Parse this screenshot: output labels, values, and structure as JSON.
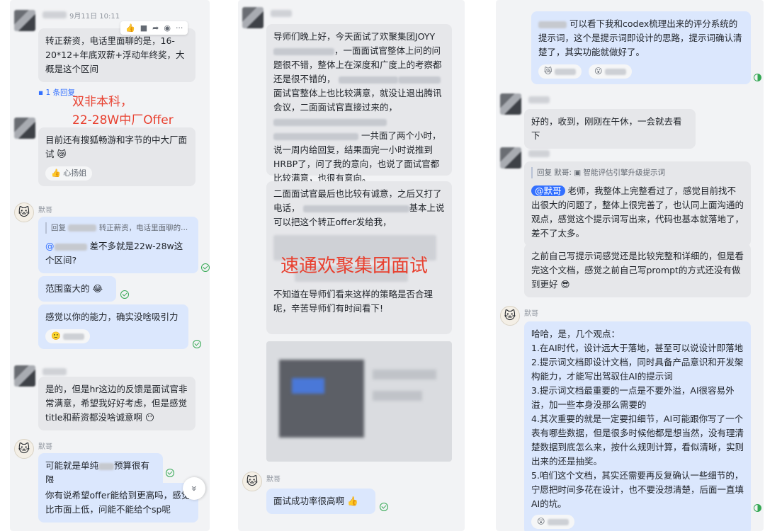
{
  "panel1": {
    "msg1_time": "9月11日 10:11",
    "toolbar_icons": [
      "👍",
      "■",
      "➦",
      "◉",
      "···"
    ],
    "msg1_text": "转正薪资，电话里面聊的是，16-20*12+年底双薪+浮动年终奖，大概是这个区间",
    "reply_count": "1 条回复",
    "red_title_1": "双非本科，",
    "red_title_2": "22-28W中厂Offer",
    "msg2_text": "目前还有搜狐畅游和字节的中大厂面试",
    "msg2_emoji": "😿",
    "msg2_reaction": "心扬姐",
    "sender_moge": "默哥",
    "msg3_quote_prefix": "回复",
    "msg3_quote_text": "转正薪资，电话里面聊的...",
    "msg3_at": "@",
    "msg3_text": "差不多就是22w-28w这个区间?",
    "msg4_text": "范围蛮大的",
    "msg4_emoji": "😂",
    "msg5_text": "感觉以你的能力，确实没啥吸引力",
    "msg5_reaction_emoji": "🙂",
    "msg6_text": "是的，但是hr这边的反馈是面试官非常满意，希望我好好考虑，但是感觉title和薪资都没啥诚意啊",
    "msg6_emoji": "😶",
    "sender_moge2": "默哥",
    "msg7_text_a": "可能就是单纯",
    "msg7_text_b": "预算很有限",
    "msg8_text": "你有说希望offer能给到更高吗，感觉比市面上低，问能不能给个sp呢",
    "fab_icon": "«"
  },
  "panel2": {
    "msg1_p1": "导师们晚上好，今天面试了欢聚集团JOYY",
    "msg1_p2": "，一面面试官整体上问的问题很不错，整体上在深度和广度上的考察都还是很不错的，",
    "msg1_p3": "面试官整体上也比较满意，就没让退出腾讯会议，二面面试官直接过来的，",
    "msg1_p4": "一共面了两个小时，说一周内给回复，结果面完一小时说推到HRBP了，问了我的意向，也说了面试官都比较满意，也很有意向。",
    "msg2_p1": "二面面试官最后也比较有诚意，之后又打了电话，",
    "msg2_p2": "基本上说可以把这个转正offer发给我，",
    "red_title": "速通欢聚集团面试",
    "msg2_p3": "不知道在导师们看来这样的策略是否合理呢，辛苦导师们有时间看下!",
    "sender_moge": "默哥",
    "msg3_text": "面试成功率很高啊",
    "msg3_emoji": "👍"
  },
  "panel3": {
    "msg1_text": "可以看下我和codex梳理出来的评分系统的提示词，这个是提示词即设计的思路，提示词确认清楚了，其实功能就做好了。",
    "msg1_reactions": [
      "😿",
      "😮"
    ],
    "msg2_text": "好的，收到，刚刚在午休，一会就去看下",
    "msg3_quote": "回复 默哥: ▣ 智能评估引擎升级提示词",
    "msg3_mention": "@默哥",
    "msg3_text": "老师，我整体上完整看过了，感觉目前找不出很大的问题了，整体上很完善了，也认同上面沟通的观点，感觉这个提示词写出来，代码也基本就落地了，差不了太多。",
    "msg4_text": "之前自己写提示词感觉还是比较完整和详细的，但是看完这个文档，感觉之前自己写prompt的方式还没有做到更好",
    "msg4_emoji": "😎",
    "sender_moge": "默哥",
    "msg5_lines": [
      "哈哈，是，几个观点：",
      "1.在AI时代，设计远大于落地，甚至可以说设计即落地",
      "2.提示词文档即设计文档，同时具备产品意识和开发架构能力，才能写出驾驭住AI的提示词",
      "3.提示词文档最重要的一点是不要外溢，AI很容易外溢，加一些本身没那么需要的",
      "4.其次重要的就是一定要扣细节，AI可能跟你写了一个表有哪些数据，但是很多时候他都是想当然，没有理清楚数据到底怎么来，按什么规则计算，看似清晰，实则出来的还是抽奖。",
      "5.咱们这个文档，其实还需要再反复确认一些细节的，宁愿把时间多花在设计，也不要没想清楚，后面一直填AI的坑。"
    ],
    "msg5_reaction_emoji": "😲"
  }
}
